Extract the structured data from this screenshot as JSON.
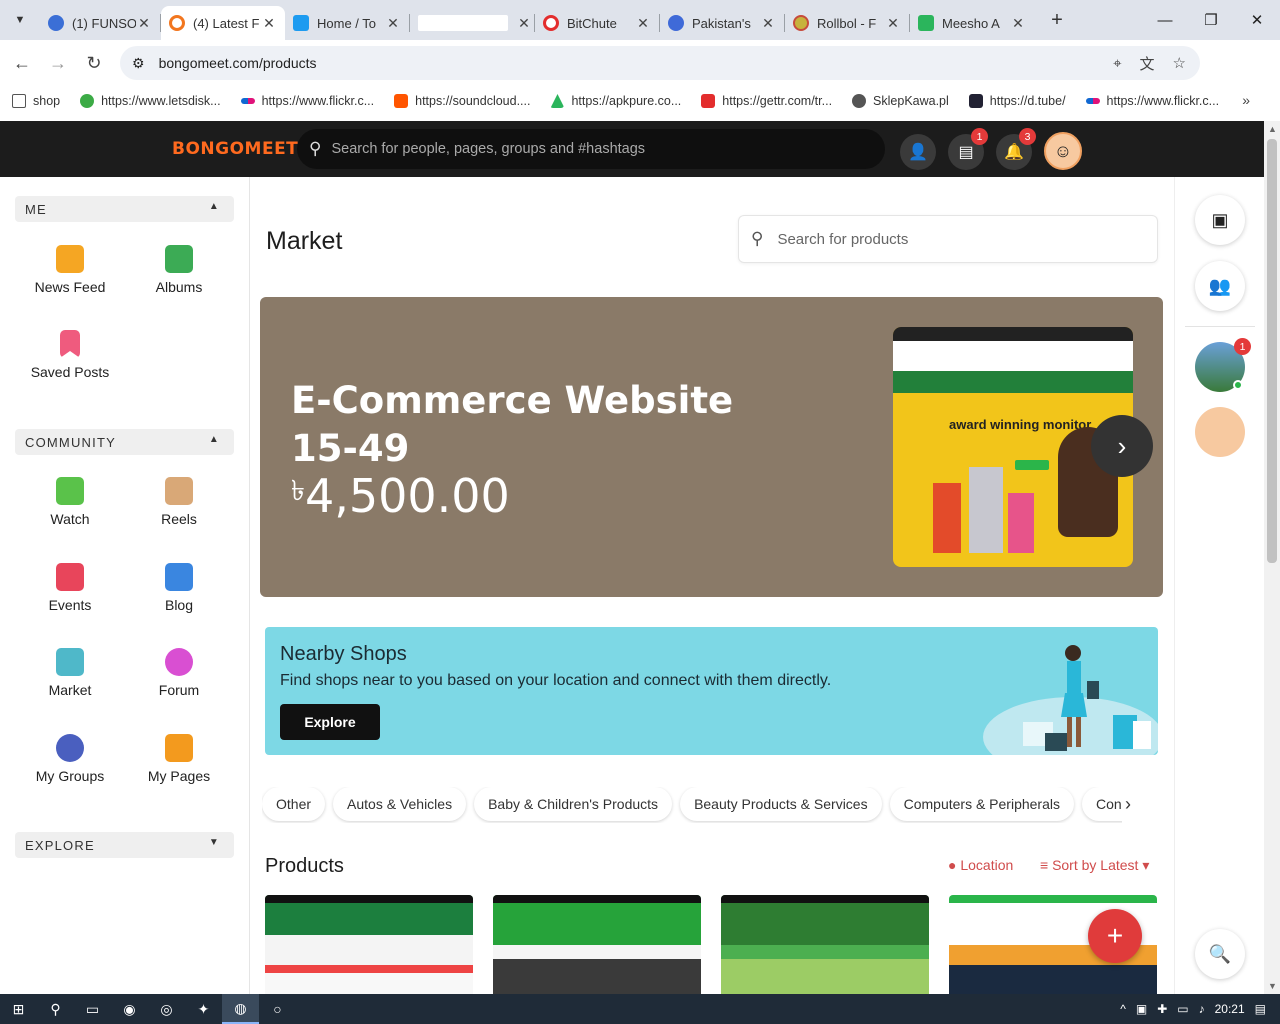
{
  "browser": {
    "tabs": [
      {
        "title": "(1) FUNSO",
        "color": "#3b6fd6",
        "active": false
      },
      {
        "title": "(4) Latest F",
        "color": "#f2761f",
        "active": true
      },
      {
        "title": "Home / To",
        "color": "#1d9bf0",
        "active": false
      },
      {
        "title": "",
        "color": "#ffffff",
        "active": false
      },
      {
        "title": "BitChute",
        "color": "#e32d2d",
        "active": false
      },
      {
        "title": "Pakistan's",
        "color": "#3f6ad8",
        "active": false
      },
      {
        "title": "Rollbol - F",
        "color": "#c74b3c",
        "active": false
      },
      {
        "title": "Meesho A",
        "color": "#2bb55c",
        "active": false
      }
    ],
    "url": "bongomeet.com/products",
    "bookmarks": [
      {
        "label": "shop",
        "color": "#555555"
      },
      {
        "label": "https://www.letsdisk...",
        "color": "#3cab46"
      },
      {
        "label": "https://www.flickr.c...",
        "color": "#e0127a"
      },
      {
        "label": "https://soundcloud....",
        "color": "#ff5500"
      },
      {
        "label": "https://apkpure.co...",
        "color": "#2bb55c"
      },
      {
        "label": "https://gettr.com/tr...",
        "color": "#e32d2d"
      },
      {
        "label": "SklepKawa.pl",
        "color": "#555555"
      },
      {
        "label": "https://d.tube/",
        "color": "#222233"
      },
      {
        "label": "https://www.flickr.c...",
        "color": "#e0127a"
      }
    ]
  },
  "site": {
    "logo": "BONGOMEET",
    "search_placeholder": "Search for people, pages, groups and #hashtags",
    "messages_badge": "1",
    "notifications_badge": "3"
  },
  "sidebar": {
    "me_label": "ME",
    "community_label": "COMMUNITY",
    "explore_label": "EXPLORE",
    "me_items": [
      "News Feed",
      "Albums",
      "Saved Posts"
    ],
    "community_items": [
      "Watch",
      "Reels",
      "Events",
      "Blog",
      "Market",
      "Forum",
      "My Groups",
      "My Pages"
    ]
  },
  "market": {
    "title": "Market",
    "search_placeholder": "Search for products",
    "hero": {
      "title_line1": "E-Commerce Website",
      "title_line2": "15-49",
      "currency": "৳",
      "price": "4,500.00",
      "image_text": "award winning monitor"
    },
    "nearby": {
      "title": "Nearby Shops",
      "subtitle": "Find shops near to you based on your location and connect with them directly.",
      "button": "Explore"
    },
    "categories": [
      "Other",
      "Autos & Vehicles",
      "Baby & Children's Products",
      "Beauty Products & Services",
      "Computers & Peripherals",
      "Cons"
    ],
    "products_title": "Products",
    "location_label": "Location",
    "sort_label": "Sort by Latest"
  },
  "rightbar": {
    "avatar_badge": "1"
  },
  "taskbar": {
    "time": "20:21"
  },
  "colors": {
    "brand": "#ff6a1f",
    "header_bg": "#1c1c1c",
    "hero_bg": "#8a7a68",
    "nearby_bg": "#7dd8e5",
    "accent_red": "#e03b3b"
  }
}
